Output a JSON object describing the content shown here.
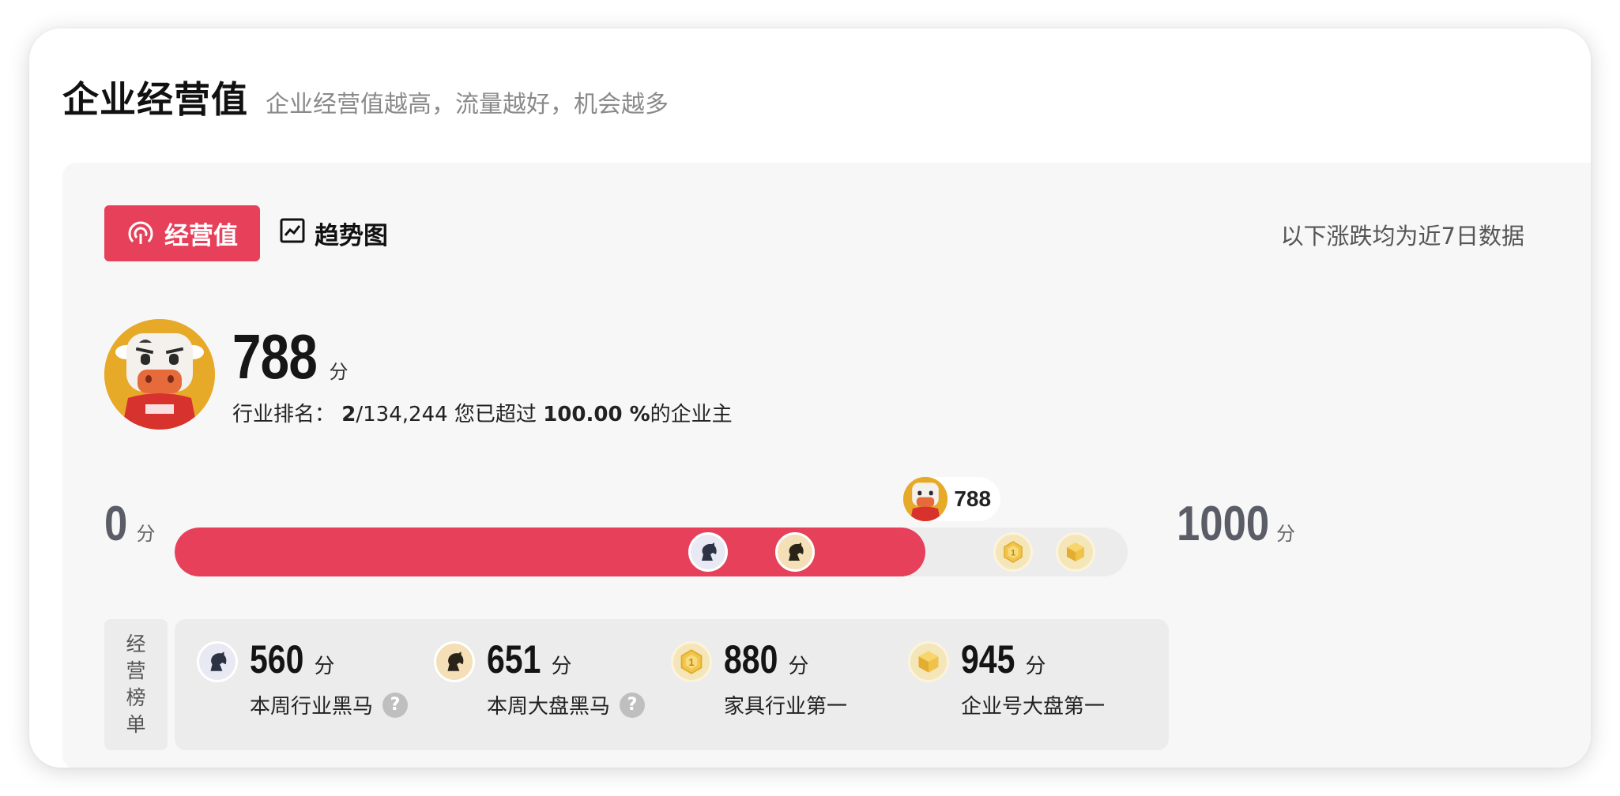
{
  "header": {
    "title": "企业经营值",
    "subtitle": "企业经营值越高，流量越好，机会越多"
  },
  "tabs": [
    {
      "label": "经营值",
      "active": true,
      "icon": "gauge-icon"
    },
    {
      "label": "趋势图",
      "active": false,
      "icon": "trend-chart-icon"
    }
  ],
  "note": "以下涨跌均为近7日数据",
  "score": {
    "value": "788",
    "unit": "分",
    "rank_label": "行业排名：",
    "rank_position": "2",
    "rank_total": "/134,244",
    "exceed_prefix": "您已超过",
    "exceed_percent": "100.00 %",
    "exceed_suffix": "的企业主"
  },
  "progress": {
    "min": "0",
    "max": "1000",
    "unit": "分",
    "current": 788,
    "current_label": "788",
    "fill_color": "#e6405a",
    "markers": [
      {
        "value": 560,
        "icon": "dark-horse-icon"
      },
      {
        "value": 651,
        "icon": "gold-horse-icon"
      },
      {
        "value": 880,
        "icon": "medal-one-icon"
      },
      {
        "value": 945,
        "icon": "gold-cube-icon"
      }
    ]
  },
  "leaderboard": {
    "label_chars": [
      "经",
      "营",
      "榜",
      "单"
    ],
    "items": [
      {
        "score": "560",
        "unit": "分",
        "name": "本周行业黑马",
        "help": true,
        "icon": "dark-horse-icon"
      },
      {
        "score": "651",
        "unit": "分",
        "name": "本周大盘黑马",
        "help": true,
        "icon": "gold-horse-icon"
      },
      {
        "score": "880",
        "unit": "分",
        "name": "家具行业第一",
        "help": false,
        "icon": "medal-one-icon"
      },
      {
        "score": "945",
        "unit": "分",
        "name": "企业号大盘第一",
        "help": false,
        "icon": "gold-cube-icon"
      }
    ],
    "help_glyph": "?"
  },
  "colors": {
    "accent": "#e6405a",
    "track": "#ececec",
    "panel": "#f7f7f8"
  }
}
